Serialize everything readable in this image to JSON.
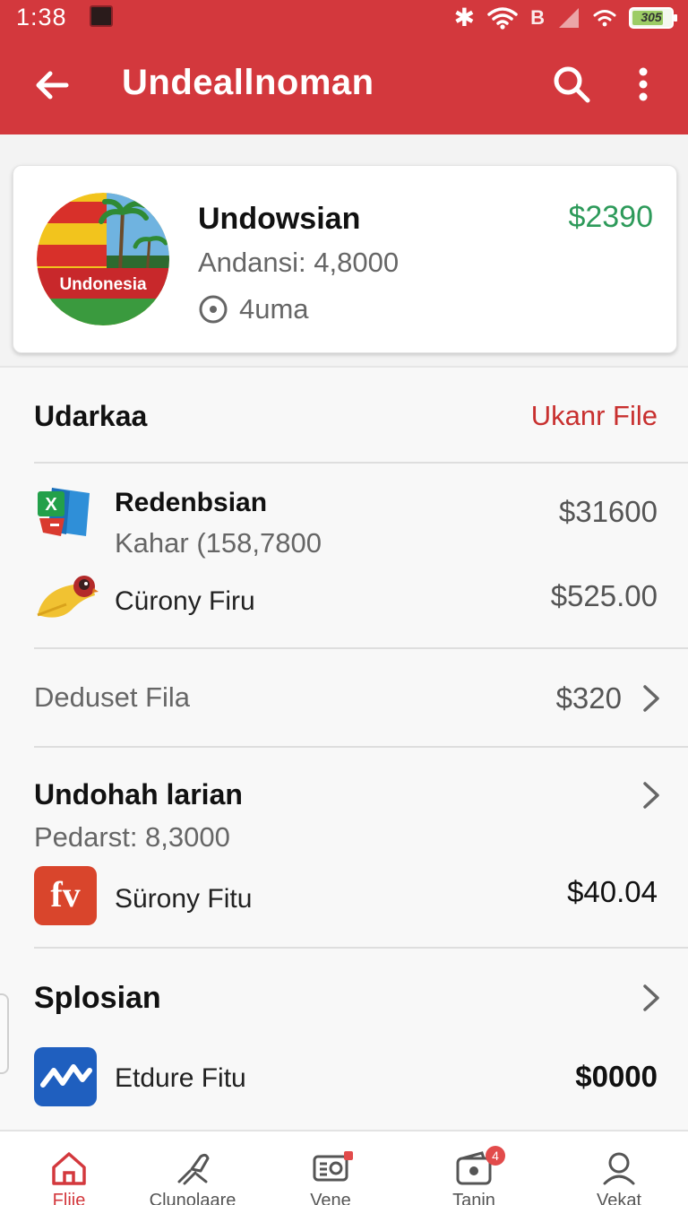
{
  "status_bar": {
    "time": "1:38",
    "notification_glyph": "",
    "battery_text": "305",
    "signal_letter": "B"
  },
  "app_bar": {
    "title": "Undeallnoman"
  },
  "profile": {
    "logo_text": "Undonesia",
    "name": "Undowsian",
    "subtitle": "Andansi: 4,8000",
    "meta": "4uma",
    "price": "$2390",
    "price_color": "#2d9a5a"
  },
  "section1": {
    "title": "Udarkaa",
    "link": "Ukanr File",
    "items": [
      {
        "title": "Redenbsian",
        "subtitle": "Kahar (158,7800",
        "amount": "$31600",
        "icon": "excel-file-icon"
      },
      {
        "title": "Cürony Firu",
        "amount": "$525.00",
        "icon": "bird-icon"
      }
    ]
  },
  "row_deduset": {
    "label": "Deduset Fila",
    "amount": "$320"
  },
  "section2": {
    "title": "Undohah larian",
    "subtitle": "Pedarst: 8,3000",
    "item": {
      "title": "Sürony Fitu",
      "amount": "$40.04",
      "icon_text": "fv",
      "icon": "fv-app-icon"
    }
  },
  "section3": {
    "title": "Splosian",
    "item": {
      "title": "Etdure Fitu",
      "amount": "$0000",
      "icon": "chart-wave-icon"
    }
  },
  "bottom_nav": [
    {
      "label": "Flije",
      "icon": "home-icon",
      "active": true
    },
    {
      "label": "Clunolaare",
      "icon": "tools-icon",
      "active": false
    },
    {
      "label": "Vene",
      "icon": "radio-icon",
      "active": false
    },
    {
      "label": "Tanin",
      "icon": "wallet-icon",
      "active": false,
      "badge": "4"
    },
    {
      "label": "Vekat",
      "icon": "profile-icon",
      "active": false
    }
  ],
  "colors": {
    "brand_red": "#d3383d",
    "link_red": "#c8302f",
    "price_green": "#2d9a5a"
  }
}
